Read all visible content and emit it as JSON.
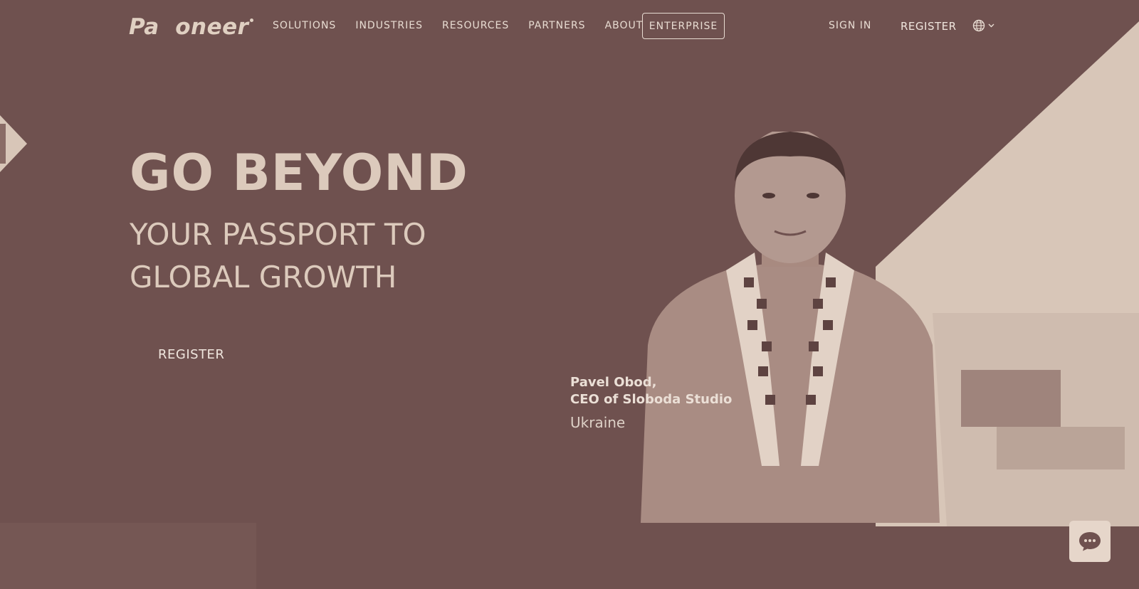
{
  "brand": {
    "logo_text": "Pa  oneer"
  },
  "nav": {
    "items": [
      {
        "label": "SOLUTIONS"
      },
      {
        "label": "INDUSTRIES"
      },
      {
        "label": "RESOURCES"
      },
      {
        "label": "PARTNERS"
      },
      {
        "label": "ABOUT"
      }
    ],
    "enterprise_label": "ENTERPRISE",
    "signin_label": "SIGN IN",
    "register_label": "REGISTER",
    "language_icon": "globe-icon"
  },
  "hero": {
    "title": "GO BEYOND",
    "subtitle": "YOUR PASSPORT TO GLOBAL GROWTH",
    "register_label": "REGISTER"
  },
  "testimonial": {
    "name": "Pavel Obod,\nCEO of Sloboda Studio",
    "country": "Ukraine"
  },
  "colors": {
    "background": "#6f514f",
    "panel": "#d8c6b8",
    "text": "#e8dcd2"
  },
  "chat": {
    "icon": "chat-bubble-icon"
  }
}
